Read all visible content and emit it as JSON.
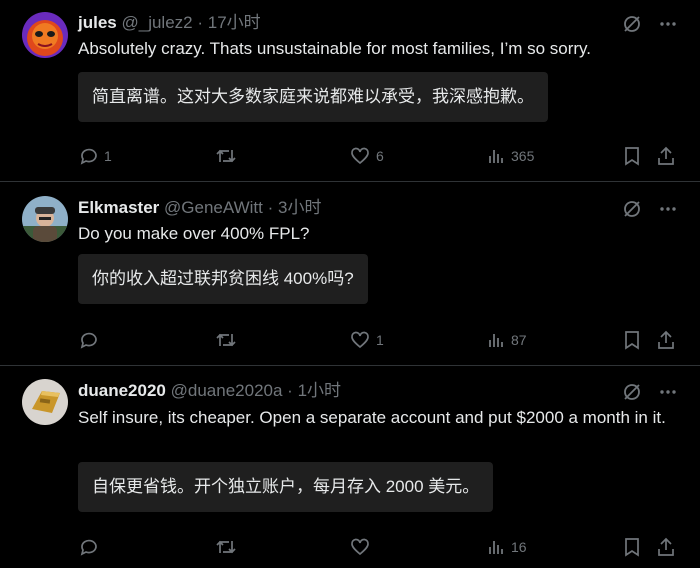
{
  "tweets": [
    {
      "name": "jules",
      "handle": "@_julez2",
      "sep": "·",
      "time": "17小时",
      "text": "Absolutely crazy. Thats unsustainable for most families, I’m so sorry.",
      "translation": "简直离谱。这对大多数家庭来说都难以承受，我深感抱歉。",
      "replies": "1",
      "retweets": "",
      "likes": "6",
      "views": "365"
    },
    {
      "name": "Elkmaster",
      "handle": "@GeneAWitt",
      "sep": "·",
      "time": "3小时",
      "text": "Do you make over 400% FPL?",
      "translation": "你的收入超过联邦贫困线 400%吗?",
      "replies": "",
      "retweets": "",
      "likes": "1",
      "views": "87"
    },
    {
      "name": "duane2020",
      "handle": "@duane2020a",
      "sep": "·",
      "time": "1小时",
      "text": "Self insure, its cheaper. Open a separate account and put $2000 a month in it.",
      "translation": "自保更省钱。开个独立账户，每月存入 2000 美元。",
      "replies": "",
      "retweets": "",
      "likes": "",
      "views": "16"
    }
  ],
  "colors": {
    "background": "#000000",
    "text": "#e7e9ea",
    "muted": "#71767b",
    "translation_bg": "#1f1f1f",
    "divider": "#2f3336"
  },
  "icons": {
    "grok": "grok-icon",
    "more": "more-icon",
    "reply": "reply-icon",
    "retweet": "retweet-icon",
    "like": "like-icon",
    "views": "views-icon",
    "bookmark": "bookmark-icon",
    "share": "share-icon"
  }
}
